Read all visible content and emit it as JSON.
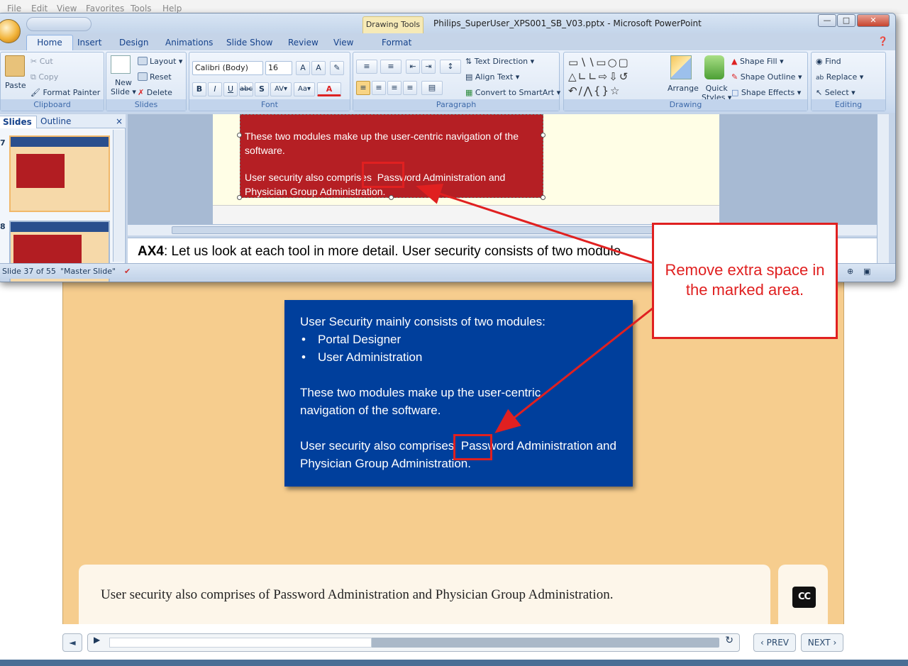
{
  "ie_menu": [
    "File",
    "Edit",
    "View",
    "Favorites",
    "Tools",
    "Help"
  ],
  "ppt": {
    "title": "Philips_SuperUser_XPS001_SB_V03.pptx - Microsoft PowerPoint",
    "contextual_tab": "Drawing Tools",
    "tabs": [
      "Home",
      "Insert",
      "Design",
      "Animations",
      "Slide Show",
      "Review",
      "View",
      "Format"
    ],
    "clipboard": {
      "paste": "Paste",
      "cut": "Cut",
      "copy": "Copy",
      "format_painter": "Format Painter",
      "label": "Clipboard"
    },
    "slides_group": {
      "new_slide_1": "New",
      "new_slide_2": "Slide",
      "layout": "Layout",
      "reset": "Reset",
      "delete": "Delete",
      "label": "Slides"
    },
    "font": {
      "name": "Calibri (Body)",
      "size": "16",
      "label": "Font"
    },
    "paragraph": {
      "text_direction": "Text Direction",
      "align_text": "Align Text",
      "smartart": "Convert to SmartArt",
      "label": "Paragraph"
    },
    "drawing": {
      "arrange": "Arrange",
      "quick_styles_1": "Quick",
      "quick_styles_2": "Styles",
      "shape_fill": "Shape Fill",
      "shape_outline": "Shape Outline",
      "shape_effects": "Shape Effects",
      "label": "Drawing"
    },
    "editing": {
      "find": "Find",
      "replace": "Replace",
      "select": "Select",
      "label": "Editing"
    },
    "pane_tabs": {
      "slides": "Slides",
      "outline": "Outline"
    },
    "thumb_numbers": [
      "7",
      "8"
    ],
    "slide_red_text": {
      "p1": "These two modules make up the user-centric navigation of the software.",
      "p2": "User security also comprises  Password Administration and Physician Group Administration."
    },
    "notes": {
      "speaker": "AX4",
      "text": ": Let us look at each tool in more detail. User security consists of two module"
    },
    "status": {
      "slide_count": "Slide 37 of 55",
      "theme": "\"Master Slide\""
    }
  },
  "slide": {
    "intro": "User Security mainly consists of two modules:",
    "bullets": [
      "Portal Designer",
      "User Administration"
    ],
    "p2": "These two modules make up the user-centric navigation of the software.",
    "p3": "User security also comprises  Password Administration and Physician Group Administration."
  },
  "caption": "User security also comprises of Password Administration and Physician Group Administration.",
  "cc_label": "CC",
  "player": {
    "prev": "PREV",
    "next": "NEXT",
    "progress": 0.43
  },
  "callout": "Remove extra space in the marked area.",
  "colors": {
    "annotation": "#e02020",
    "slide_blue": "#003f9c",
    "slide_red": "#b51f24",
    "course_bg": "#f6cd8e"
  }
}
